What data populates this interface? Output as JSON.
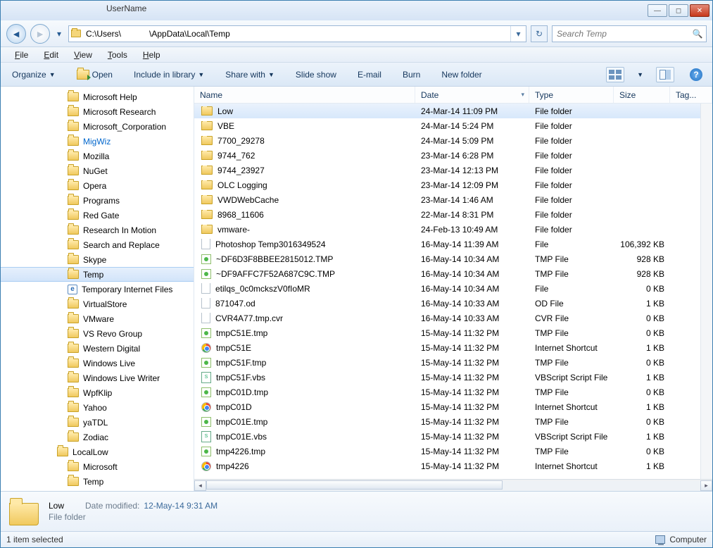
{
  "titlebar": {
    "user": "UserName"
  },
  "address": {
    "path": "C:\\Users\\            \\AppData\\Local\\Temp",
    "search_placeholder": "Search Temp"
  },
  "menu": [
    "File",
    "Edit",
    "View",
    "Tools",
    "Help"
  ],
  "toolbar": {
    "organize": "Organize",
    "open": "Open",
    "include": "Include in library",
    "share": "Share with",
    "slideshow": "Slide show",
    "email": "E-mail",
    "burn": "Burn",
    "newfolder": "New folder"
  },
  "columns": {
    "name": "Name",
    "date": "Date",
    "type": "Type",
    "size": "Size",
    "tags": "Tag..."
  },
  "tree": [
    {
      "label": "Microsoft Help",
      "icon": "folder",
      "level": 3
    },
    {
      "label": "Microsoft Research",
      "icon": "folder",
      "level": 3
    },
    {
      "label": "Microsoft_Corporation",
      "icon": "folder",
      "level": 3
    },
    {
      "label": "MigWiz",
      "icon": "folder",
      "level": 3,
      "link": true
    },
    {
      "label": "Mozilla",
      "icon": "folder",
      "level": 3
    },
    {
      "label": "NuGet",
      "icon": "folder",
      "level": 3
    },
    {
      "label": "Opera",
      "icon": "folder",
      "level": 3
    },
    {
      "label": "Programs",
      "icon": "folder",
      "level": 3
    },
    {
      "label": "Red Gate",
      "icon": "folder",
      "level": 3
    },
    {
      "label": "Research In Motion",
      "icon": "folder",
      "level": 3
    },
    {
      "label": "Search and Replace",
      "icon": "folder",
      "level": 3
    },
    {
      "label": "Skype",
      "icon": "folder",
      "level": 3
    },
    {
      "label": "Temp",
      "icon": "folder",
      "level": 3,
      "selected": true
    },
    {
      "label": "Temporary Internet Files",
      "icon": "ie",
      "level": 3
    },
    {
      "label": "VirtualStore",
      "icon": "folder",
      "level": 3
    },
    {
      "label": "VMware",
      "icon": "folder",
      "level": 3
    },
    {
      "label": "VS Revo Group",
      "icon": "folder",
      "level": 3
    },
    {
      "label": "Western Digital",
      "icon": "folder",
      "level": 3
    },
    {
      "label": "Windows Live",
      "icon": "folder",
      "level": 3
    },
    {
      "label": "Windows Live Writer",
      "icon": "folder",
      "level": 3
    },
    {
      "label": "WpfKlip",
      "icon": "folder",
      "level": 3
    },
    {
      "label": "Yahoo",
      "icon": "folder",
      "level": 3
    },
    {
      "label": "yaTDL",
      "icon": "folder",
      "level": 3
    },
    {
      "label": "Zodiac",
      "icon": "folder",
      "level": 3
    },
    {
      "label": "LocalLow",
      "icon": "folder",
      "level": 2
    },
    {
      "label": "Microsoft",
      "icon": "folder",
      "level": 3
    },
    {
      "label": "Temp",
      "icon": "folder",
      "level": 3
    }
  ],
  "files": [
    {
      "icon": "folder",
      "name": "Low",
      "date": "24-Mar-14 11:09 PM",
      "type": "File folder",
      "size": "",
      "selected": true
    },
    {
      "icon": "folder",
      "name": "VBE",
      "date": "24-Mar-14 5:24 PM",
      "type": "File folder",
      "size": ""
    },
    {
      "icon": "folder",
      "name": "7700_29278",
      "date": "24-Mar-14 5:09 PM",
      "type": "File folder",
      "size": ""
    },
    {
      "icon": "folder",
      "name": "9744_762",
      "date": "23-Mar-14 6:28 PM",
      "type": "File folder",
      "size": ""
    },
    {
      "icon": "folder",
      "name": "9744_23927",
      "date": "23-Mar-14 12:13 PM",
      "type": "File folder",
      "size": ""
    },
    {
      "icon": "folder",
      "name": "OLC Logging",
      "date": "23-Mar-14 12:09 PM",
      "type": "File folder",
      "size": ""
    },
    {
      "icon": "folder",
      "name": "VWDWebCache",
      "date": "23-Mar-14 1:46 AM",
      "type": "File folder",
      "size": ""
    },
    {
      "icon": "folder",
      "name": "8968_11606",
      "date": "22-Mar-14 8:31 PM",
      "type": "File folder",
      "size": ""
    },
    {
      "icon": "folder",
      "name": "vmware-",
      "date": "24-Feb-13 10:49 AM",
      "type": "File folder",
      "size": ""
    },
    {
      "icon": "file",
      "name": "Photoshop Temp3016349524",
      "date": "16-May-14 11:39 AM",
      "type": "File",
      "size": "106,392 KB"
    },
    {
      "icon": "tmp",
      "name": "~DF6D3F8BBEE2815012.TMP",
      "date": "16-May-14 10:34 AM",
      "type": "TMP File",
      "size": "928 KB"
    },
    {
      "icon": "tmp",
      "name": "~DF9AFFC7F52A687C9C.TMP",
      "date": "16-May-14 10:34 AM",
      "type": "TMP File",
      "size": "928 KB"
    },
    {
      "icon": "file",
      "name": "etilqs_0c0mckszV0fIoMR",
      "date": "16-May-14 10:34 AM",
      "type": "File",
      "size": "0 KB"
    },
    {
      "icon": "file",
      "name": "871047.od",
      "date": "16-May-14 10:33 AM",
      "type": "OD File",
      "size": "1 KB"
    },
    {
      "icon": "file",
      "name": "CVR4A77.tmp.cvr",
      "date": "16-May-14 10:33 AM",
      "type": "CVR File",
      "size": "0 KB"
    },
    {
      "icon": "tmp",
      "name": "tmpC51E.tmp",
      "date": "15-May-14 11:32 PM",
      "type": "TMP File",
      "size": "0 KB"
    },
    {
      "icon": "chrome",
      "name": "tmpC51E",
      "date": "15-May-14 11:32 PM",
      "type": "Internet Shortcut",
      "size": "1 KB"
    },
    {
      "icon": "tmp",
      "name": "tmpC51F.tmp",
      "date": "15-May-14 11:32 PM",
      "type": "TMP File",
      "size": "0 KB"
    },
    {
      "icon": "vbs",
      "name": "tmpC51F.vbs",
      "date": "15-May-14 11:32 PM",
      "type": "VBScript Script File",
      "size": "1 KB"
    },
    {
      "icon": "tmp",
      "name": "tmpC01D.tmp",
      "date": "15-May-14 11:32 PM",
      "type": "TMP File",
      "size": "0 KB"
    },
    {
      "icon": "chrome",
      "name": "tmpC01D",
      "date": "15-May-14 11:32 PM",
      "type": "Internet Shortcut",
      "size": "1 KB"
    },
    {
      "icon": "tmp",
      "name": "tmpC01E.tmp",
      "date": "15-May-14 11:32 PM",
      "type": "TMP File",
      "size": "0 KB"
    },
    {
      "icon": "vbs",
      "name": "tmpC01E.vbs",
      "date": "15-May-14 11:32 PM",
      "type": "VBScript Script File",
      "size": "1 KB"
    },
    {
      "icon": "tmp",
      "name": "tmp4226.tmp",
      "date": "15-May-14 11:32 PM",
      "type": "TMP File",
      "size": "0 KB"
    },
    {
      "icon": "chrome",
      "name": "tmp4226",
      "date": "15-May-14 11:32 PM",
      "type": "Internet Shortcut",
      "size": "1 KB"
    }
  ],
  "details": {
    "name": "Low",
    "type_label": "File folder",
    "modified_label": "Date modified:",
    "modified": "12-May-14 9:31 AM"
  },
  "status": {
    "selection": "1 item selected",
    "location": "Computer"
  }
}
